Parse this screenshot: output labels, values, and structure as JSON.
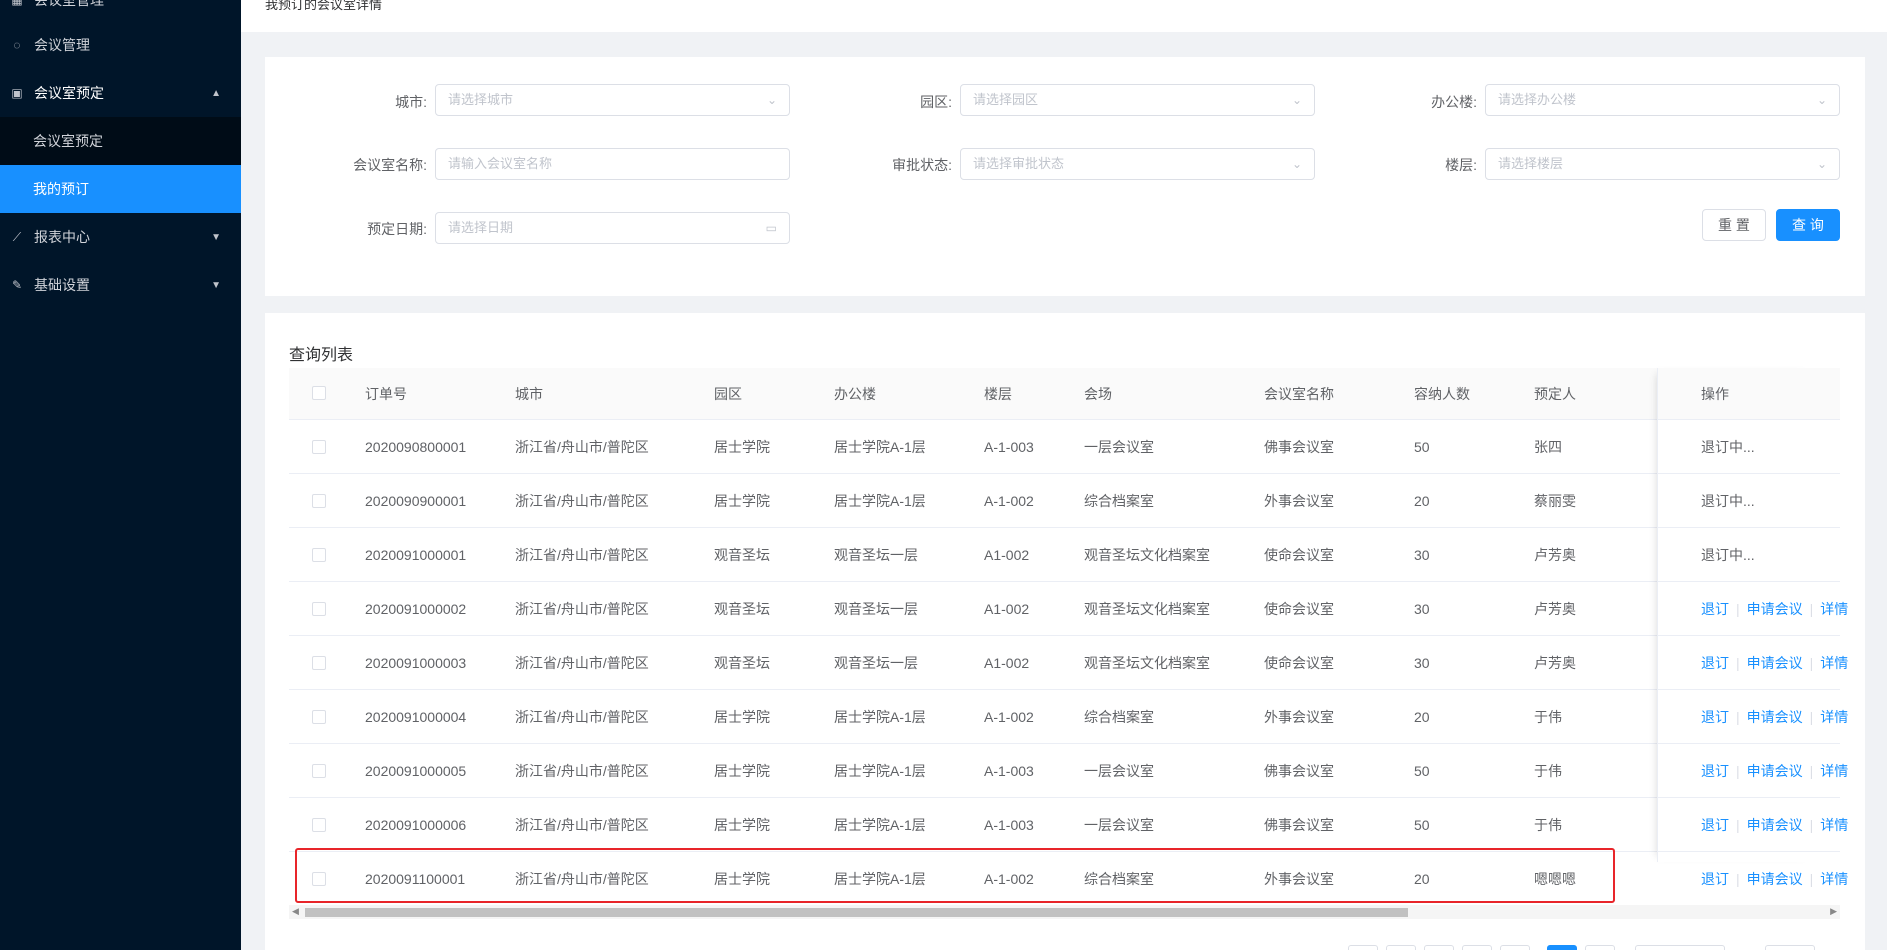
{
  "sidebar": {
    "items": [
      {
        "label": "会议室管理"
      },
      {
        "label": "会议管理"
      },
      {
        "label": "会议室预定"
      },
      {
        "label": "报表中心"
      },
      {
        "label": "基础设置"
      }
    ],
    "sub": [
      {
        "label": "会议室预定"
      },
      {
        "label": "我的预订"
      }
    ]
  },
  "topbar": {
    "title": "我预订的会议室详情"
  },
  "search": {
    "city_label": "城市:",
    "city_placeholder": "请选择城市",
    "park_label": "园区:",
    "park_placeholder": "请选择园区",
    "building_label": "办公楼:",
    "building_placeholder": "请选择办公楼",
    "room_label": "会议室名称:",
    "room_placeholder": "请输入会议室名称",
    "approval_label": "审批状态:",
    "approval_placeholder": "请选择审批状态",
    "floor_label": "楼层:",
    "floor_placeholder": "请选择楼层",
    "date_label": "预定日期:",
    "date_placeholder": "请选择日期",
    "reset": "重 置",
    "query": "查 询"
  },
  "table": {
    "title": "查询列表",
    "headers": [
      "订单号",
      "城市",
      "园区",
      "办公楼",
      "楼层",
      "会场",
      "会议室名称",
      "容纳人数",
      "预定人",
      "操作"
    ],
    "rows": [
      {
        "order": "2020090800001",
        "city": "浙江省/舟山市/普陀区",
        "park": "居士学院",
        "building": "居士学院A-1层",
        "floor": "A-1-003",
        "venue": "一层会议室",
        "room": "佛事会议室",
        "capacity": "50",
        "booker": "张四",
        "status": "退订中..."
      },
      {
        "order": "2020090900001",
        "city": "浙江省/舟山市/普陀区",
        "park": "居士学院",
        "building": "居士学院A-1层",
        "floor": "A-1-002",
        "venue": "综合档案室",
        "room": "外事会议室",
        "capacity": "20",
        "booker": "蔡丽雯",
        "status": "退订中..."
      },
      {
        "order": "2020091000001",
        "city": "浙江省/舟山市/普陀区",
        "park": "观音圣坛",
        "building": "观音圣坛一层",
        "floor": "A1-002",
        "venue": "观音圣坛文化档案室",
        "room": "使命会议室",
        "capacity": "30",
        "booker": "卢芳奥",
        "status": "退订中..."
      },
      {
        "order": "2020091000002",
        "city": "浙江省/舟山市/普陀区",
        "park": "观音圣坛",
        "building": "观音圣坛一层",
        "floor": "A1-002",
        "venue": "观音圣坛文化档案室",
        "room": "使命会议室",
        "capacity": "30",
        "booker": "卢芳奥",
        "status": ""
      },
      {
        "order": "2020091000003",
        "city": "浙江省/舟山市/普陀区",
        "park": "观音圣坛",
        "building": "观音圣坛一层",
        "floor": "A1-002",
        "venue": "观音圣坛文化档案室",
        "room": "使命会议室",
        "capacity": "30",
        "booker": "卢芳奥",
        "status": ""
      },
      {
        "order": "2020091000004",
        "city": "浙江省/舟山市/普陀区",
        "park": "居士学院",
        "building": "居士学院A-1层",
        "floor": "A-1-002",
        "venue": "综合档案室",
        "room": "外事会议室",
        "capacity": "20",
        "booker": "于伟",
        "status": ""
      },
      {
        "order": "2020091000005",
        "city": "浙江省/舟山市/普陀区",
        "park": "居士学院",
        "building": "居士学院A-1层",
        "floor": "A-1-003",
        "venue": "一层会议室",
        "room": "佛事会议室",
        "capacity": "50",
        "booker": "于伟",
        "status": ""
      },
      {
        "order": "2020091000006",
        "city": "浙江省/舟山市/普陀区",
        "park": "居士学院",
        "building": "居士学院A-1层",
        "floor": "A-1-003",
        "venue": "一层会议室",
        "room": "佛事会议室",
        "capacity": "50",
        "booker": "于伟",
        "status": ""
      },
      {
        "order": "2020091100001",
        "city": "浙江省/舟山市/普陀区",
        "park": "居士学院",
        "building": "居士学院A-1层",
        "floor": "A-1-002",
        "venue": "综合档案室",
        "room": "外事会议室",
        "capacity": "20",
        "booker": "嗯嗯嗯",
        "status": ""
      }
    ],
    "actions": {
      "cancel": "退订",
      "apply": "申请会议",
      "detail": "详情"
    }
  },
  "colors": {
    "sidebar_bg": "#001529",
    "accent": "#1890ff",
    "highlight": "#e8252a"
  }
}
